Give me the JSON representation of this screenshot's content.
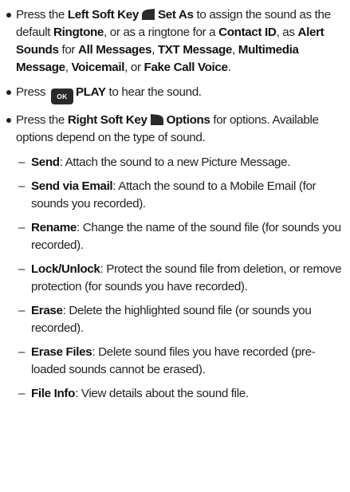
{
  "b1": {
    "t1": "Press the ",
    "k1": "Left Soft Key",
    "k2": "Set As",
    "t2": " to assign the sound as the default ",
    "k3": "Ringtone",
    "t3": ", or as a ringtone for a ",
    "k4": "Contact ID",
    "t4": ", as ",
    "k5": "Alert Sounds",
    "t5": " for ",
    "k6": "All Messages",
    "t6": ", ",
    "k7": "TXT Message",
    "t7": ", ",
    "k8": "Multimedia Message",
    "t8": ", ",
    "k9": "Voicemail",
    "t9": ", or ",
    "k10": "Fake Call Voice",
    "t10": "."
  },
  "b2": {
    "t1": "Press ",
    "ok_label": "OK",
    "k1": "PLAY",
    "t2": " to hear the sound."
  },
  "b3": {
    "t1": "Press the ",
    "k1": "Right Soft Key",
    "k2": "Options",
    "t2": " for options. Available options depend on the type of sound."
  },
  "dash": "–",
  "options": [
    {
      "name": "Send",
      "desc": ": Attach the sound to a new Picture Message."
    },
    {
      "name": "Send via Email",
      "desc": ": Attach the sound to a Mobile Email (for sounds you recorded)."
    },
    {
      "name": "Rename",
      "desc": ": Change the name of the sound file (for sounds you recorded)."
    },
    {
      "name": "Lock/Unlock",
      "desc": ": Protect the sound file from deletion, or remove protection (for sounds you have recorded)."
    },
    {
      "name": "Erase",
      "desc": ": Delete the highlighted sound file (or sounds you recorded)."
    },
    {
      "name": "Erase Files",
      "desc": ": Delete sound files you have recorded (pre-loaded sounds cannot be erased)."
    },
    {
      "name": "File Info",
      "desc": ": View details about the sound file."
    }
  ]
}
